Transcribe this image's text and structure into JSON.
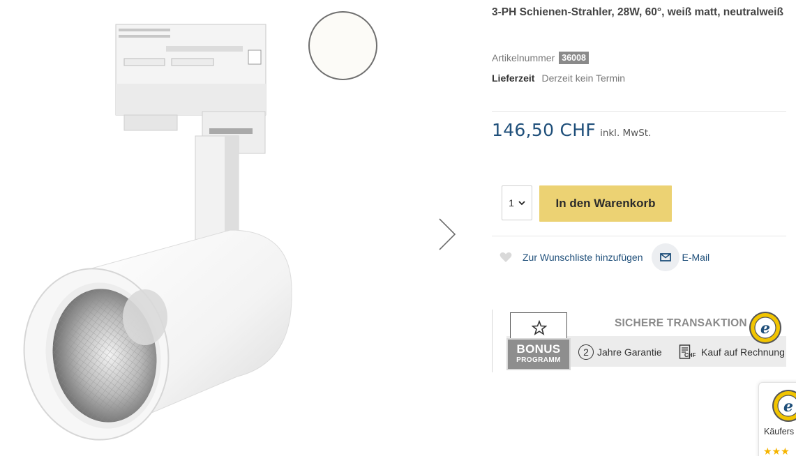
{
  "product": {
    "title": "3-PH Schienen-Strahler, 28W, 60°, weiß matt, neutralweiß",
    "image_icon": "track-spotlight-image",
    "swatch_color": "#fcfbf7",
    "sku_label": "Artikelnummer",
    "sku_value": "36008",
    "delivery_label": "Lieferzeit",
    "delivery_value": "Derzeit kein Termin",
    "price": "146,50 CHF",
    "vat_note": "inkl. MwSt."
  },
  "purchase": {
    "quantity": "1",
    "add_to_cart_label": "In den Warenkorb",
    "button_color": "#ecd273"
  },
  "actions": {
    "wishlist_label": "Zur Wunschliste hinzufügen",
    "email_label": "E-Mail"
  },
  "trust_banner": {
    "bonus_title": "BONUS",
    "bonus_subtitle": "PROGRAMM",
    "secure_title": "SICHERE TRANSAKTION",
    "guarantee_number": "2",
    "guarantee_label": "2 Jahre Garantie",
    "invoice_label": "Kauf auf Rechnung",
    "seal_text": "TRUSTED SHOPS GUARANTEE"
  },
  "trusted_shops_widget": {
    "label": "Käufers",
    "stars": "★★★"
  },
  "colors": {
    "link": "#1f4f7a",
    "price": "#1f4f7a",
    "accent": "#ecd273"
  }
}
